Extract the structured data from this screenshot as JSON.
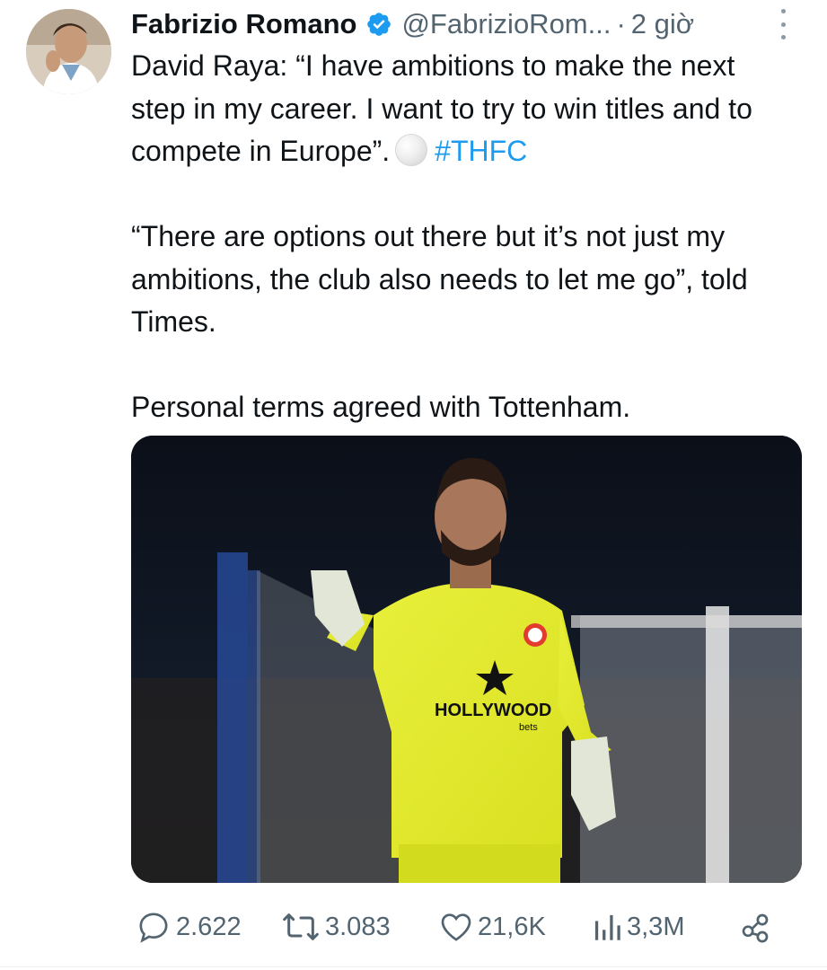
{
  "tweet": {
    "author": {
      "name": "Fabrizio Romano",
      "handle": "@FabrizioRom...",
      "separator": "·",
      "time": "2 giờ",
      "avatar_icon": "user-avatar-photo",
      "verified_icon": "verified-badge-icon"
    },
    "text": {
      "paragraph1": "David Raya: “I have ambitions to make the next step in my career. I want to try to win titles and to compete in Europe”.",
      "hashtag": "#THFC",
      "paragraph2": "“There are options out there but it’s not just my ambitions, the club also needs to let me go”, told Times.",
      "paragraph3": "Personal terms agreed with Tottenham."
    },
    "media": {
      "shirt_sponsor": "HOLLYWOOD",
      "shirt_sponsor_sub": "bets"
    },
    "actions": {
      "replies": "2.622",
      "reposts": "3.083",
      "likes": "21,6K",
      "views": "3,3M"
    }
  },
  "colors": {
    "link": "#1d9bf0",
    "verified": "#1d9bf0",
    "secondary_text": "#536471",
    "primary_text": "#0f1419"
  }
}
